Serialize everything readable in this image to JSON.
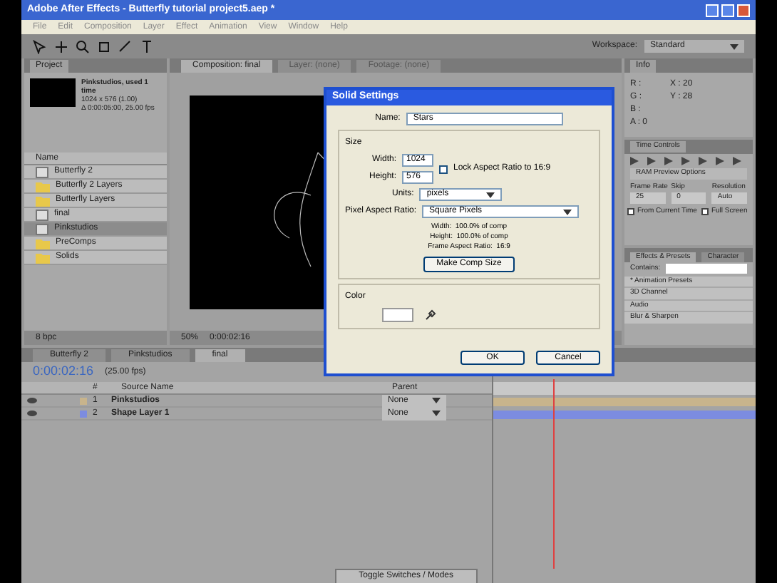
{
  "window": {
    "title": "Adobe After Effects - Butterfly tutorial project5.aep *"
  },
  "menu": [
    "File",
    "Edit",
    "Composition",
    "Layer",
    "Effect",
    "Animation",
    "View",
    "Window",
    "Help"
  ],
  "workspace": {
    "label": "Workspace:",
    "value": "Standard"
  },
  "project": {
    "tab": "Project",
    "info": [
      "Pinkstudios, used 1 time",
      "1024 x 576 (1.00)",
      "Δ 0:00:05:00, 25.00 fps"
    ],
    "column": "Name",
    "items": [
      {
        "name": "Butterfly 2",
        "kind": "comp",
        "selected": false
      },
      {
        "name": "Butterfly 2 Layers",
        "kind": "folder",
        "selected": false
      },
      {
        "name": "Butterfly Layers",
        "kind": "folder",
        "selected": false
      },
      {
        "name": "final",
        "kind": "comp",
        "selected": false
      },
      {
        "name": "Pinkstudios",
        "kind": "comp",
        "selected": true
      },
      {
        "name": "PreComps",
        "kind": "folder",
        "selected": false
      },
      {
        "name": "Solids",
        "kind": "folder",
        "selected": false
      }
    ],
    "bpc": "8 bpc"
  },
  "viewer_tabs": [
    {
      "label": "Composition: final",
      "selected": true
    },
    {
      "label": "Layer: (none)",
      "selected": false
    },
    {
      "label": "Footage: (none)",
      "selected": false
    }
  ],
  "viewer_bar": [
    "50%",
    "0:00:02:16"
  ],
  "info": {
    "tab": "Info",
    "left": [
      "R :",
      "G :",
      "B :",
      "A : 0"
    ],
    "right": [
      "X : 20",
      "Y : 28"
    ]
  },
  "time_controls": {
    "tab": "Time Controls",
    "ram": "RAM Preview Options",
    "labels": [
      "Frame Rate",
      "Skip",
      "Resolution"
    ],
    "values": [
      "25",
      "0",
      "Auto"
    ],
    "checks": [
      {
        "label": "From Current Time",
        "checked": false
      },
      {
        "label": "Full Screen",
        "checked": false
      }
    ]
  },
  "effects": {
    "tabs": [
      {
        "label": "Effects & Presets",
        "selected": true
      },
      {
        "label": "Character",
        "selected": false
      }
    ],
    "search_label": "Contains:",
    "items": [
      "* Animation Presets",
      "3D Channel",
      "Audio",
      "Blur & Sharpen"
    ]
  },
  "timeline": {
    "tabs": [
      {
        "label": "Butterfly 2",
        "selected": false
      },
      {
        "label": "Pinkstudios",
        "selected": false
      },
      {
        "label": "final",
        "selected": true
      }
    ],
    "time": "0:00:02:16",
    "fps": "(25.00 fps)",
    "columns": [
      "#",
      "Source Name",
      "Parent"
    ],
    "layers": [
      {
        "index": "1",
        "name": "Pinkstudios",
        "parent": "None",
        "color": "#c8b48c"
      },
      {
        "index": "2",
        "name": "Shape Layer 1",
        "parent": "None",
        "color": "#7c8ce0"
      }
    ],
    "toggle": "Toggle Switches / Modes"
  },
  "dialog": {
    "title": "Solid Settings",
    "name_label": "Name:",
    "name_value": "Stars",
    "size_group": "Size",
    "width_label": "Width:",
    "width_value": "1024",
    "height_label": "Height:",
    "height_value": "576",
    "lock": {
      "label": "Lock Aspect Ratio to 16:9",
      "checked": false
    },
    "units_label": "Units:",
    "units_value": "pixels",
    "par_label": "Pixel Aspect Ratio:",
    "par_value": "Square Pixels",
    "notes": [
      "Width:  100.0% of comp",
      "Height:  100.0% of comp",
      "Frame Aspect Ratio:  16:9"
    ],
    "make_comp": "Make Comp Size",
    "color_group": "Color",
    "color": "#ffffff",
    "ok": "OK",
    "cancel": "Cancel"
  }
}
